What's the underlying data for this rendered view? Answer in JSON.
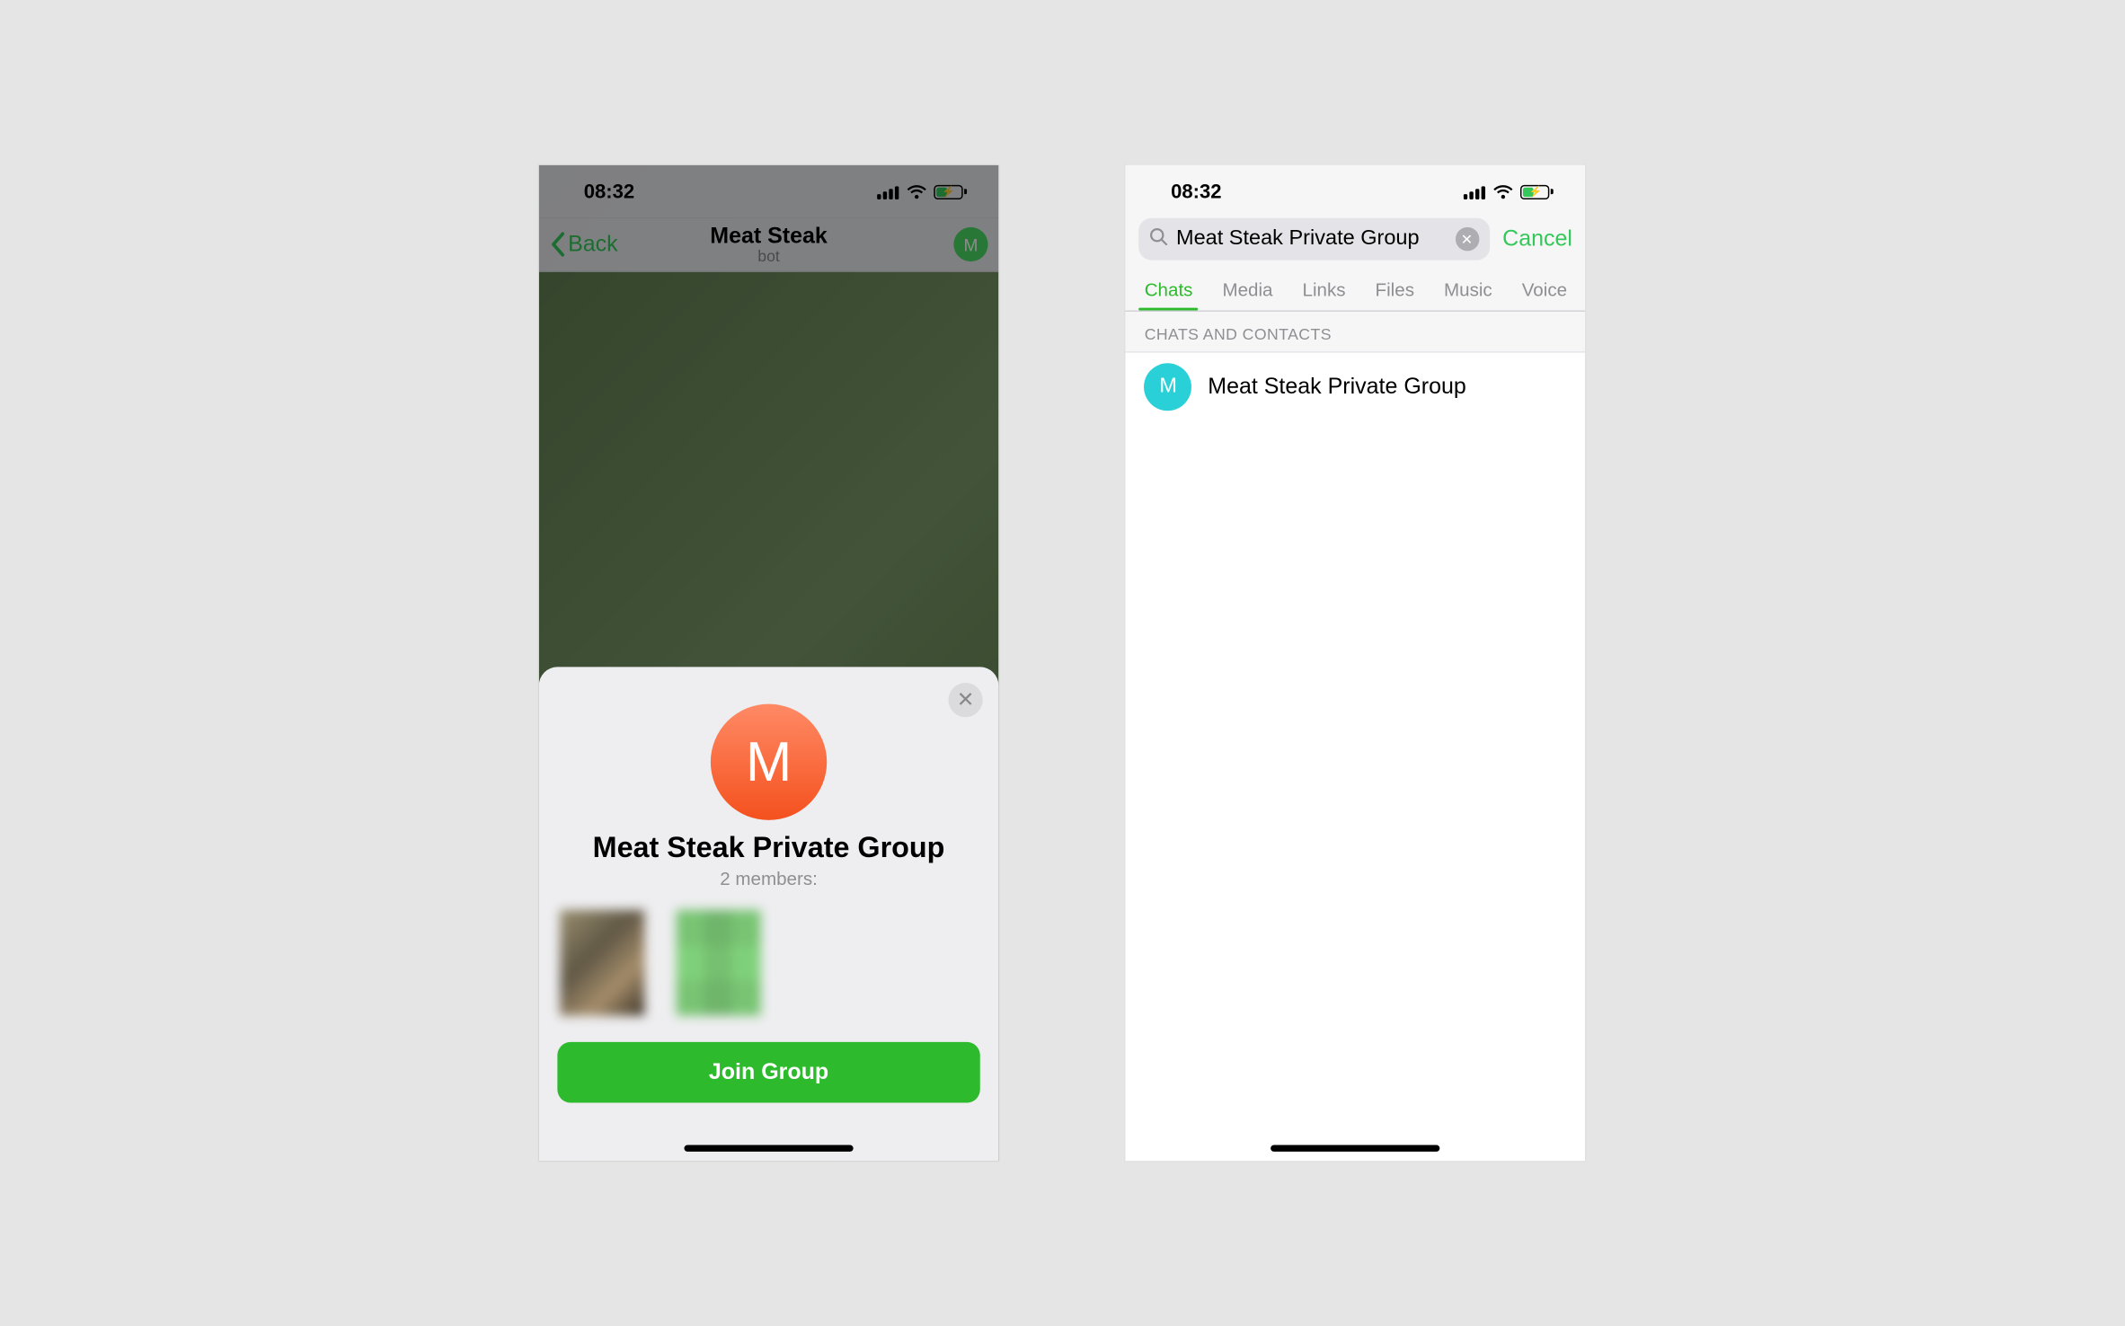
{
  "status": {
    "time": "08:32"
  },
  "phone1": {
    "back_label": "Back",
    "chat_title": "Meat Steak",
    "chat_subtitle": "bot",
    "nav_avatar_letter": "M",
    "sheet": {
      "avatar_letter": "M",
      "title": "Meat Steak Private Group",
      "members_text": "2 members:",
      "join_label": "Join Group"
    }
  },
  "phone2": {
    "search_value": "Meat Steak Private Group",
    "cancel_label": "Cancel",
    "tabs": [
      "Chats",
      "Media",
      "Links",
      "Files",
      "Music",
      "Voice"
    ],
    "active_tab_index": 0,
    "section_header": "CHATS AND CONTACTS",
    "results": [
      {
        "avatar_letter": "M",
        "name": "Meat Steak Private Group"
      }
    ]
  }
}
